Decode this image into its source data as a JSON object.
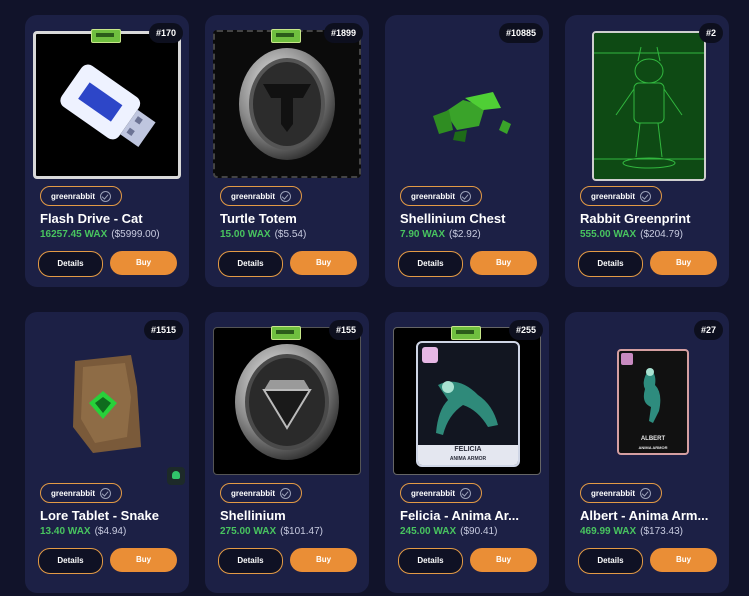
{
  "listings": [
    {
      "badge": "#170",
      "collection": "greenrabbit",
      "title": "Flash Drive - Cat",
      "price_wax": "16257.45 WAX",
      "price_usd": "($5999.00)",
      "details_label": "Details",
      "buy_label": "Buy"
    },
    {
      "badge": "#1899",
      "collection": "greenrabbit",
      "title": "Turtle Totem",
      "price_wax": "15.00 WAX",
      "price_usd": "($5.54)",
      "details_label": "Details",
      "buy_label": "Buy"
    },
    {
      "badge": "#10885",
      "collection": "greenrabbit",
      "title": "Shellinium Chest",
      "price_wax": "7.90 WAX",
      "price_usd": "($2.92)",
      "details_label": "Details",
      "buy_label": "Buy"
    },
    {
      "badge": "#2",
      "collection": "greenrabbit",
      "title": "Rabbit Greenprint",
      "price_wax": "555.00 WAX",
      "price_usd": "($204.79)",
      "details_label": "Details",
      "buy_label": "Buy"
    },
    {
      "badge": "#1515",
      "collection": "greenrabbit",
      "title": "Lore Tablet - Snake",
      "price_wax": "13.40 WAX",
      "price_usd": "($4.94)",
      "details_label": "Details",
      "buy_label": "Buy"
    },
    {
      "badge": "#155",
      "collection": "greenrabbit",
      "title": "Shellinium",
      "price_wax": "275.00 WAX",
      "price_usd": "($101.47)",
      "details_label": "Details",
      "buy_label": "Buy"
    },
    {
      "badge": "#255",
      "collection": "greenrabbit",
      "title": "Felicia - Anima Ar...",
      "price_wax": "245.00 WAX",
      "price_usd": "($90.41)",
      "details_label": "Details",
      "buy_label": "Buy",
      "card_name": "FELICIA",
      "card_sub": "ANIMA ARMOR"
    },
    {
      "badge": "#27",
      "collection": "greenrabbit",
      "title": "Albert - Anima Arm...",
      "price_wax": "469.99 WAX",
      "price_usd": "($173.43)",
      "details_label": "Details",
      "buy_label": "Buy",
      "card_name": "ALBERT",
      "card_sub": "ANIMA ARMOR"
    }
  ]
}
